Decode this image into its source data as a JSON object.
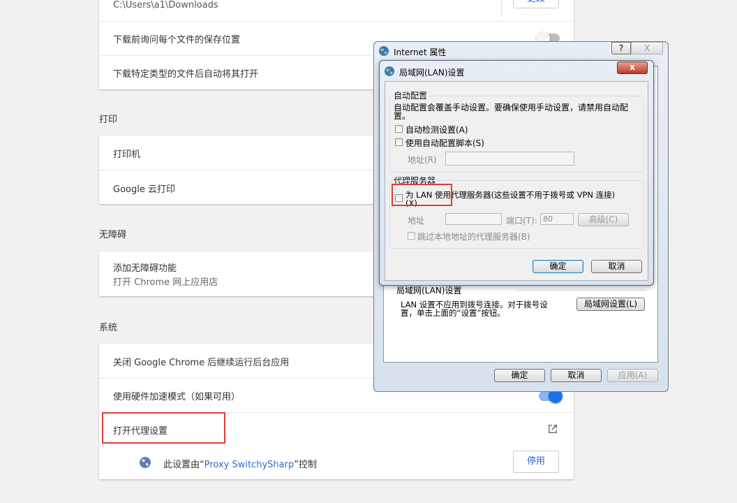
{
  "downloads": {
    "path": "C:\\Users\\a1\\Downloads",
    "change_label": "更改",
    "ask_where": "下载前询问每个文件的保存位置",
    "auto_open": "下载特定类型的文件后自动将其打开"
  },
  "print": {
    "section": "打印",
    "printers": "打印机",
    "cloud_print": "Google 云打印"
  },
  "accessibility": {
    "section": "无障碍",
    "add_title": "添加无障碍功能",
    "add_sub": "打开 Chrome 网上应用店"
  },
  "system": {
    "section": "系统",
    "background_apps": "关闭 Google Chrome 后继续运行后台应用",
    "hardware_accel": "使用硬件加速模式（如果可用）",
    "proxy": "打开代理设置",
    "ext_prefix": "此设置由“",
    "ext_name": "Proxy SwitchySharp",
    "ext_suffix": "”控制",
    "disable_label": "停用"
  },
  "inet": {
    "title": "Internet 属性",
    "help": "?",
    "close": "X",
    "lan_group": "局域网(LAN)设置",
    "lan_desc1": "LAN 设置不应用到拨号连接。对于拨号设",
    "lan_desc2": "置，单击上面的“设置”按钮。",
    "lan_button": "局域网设置(L)",
    "ok": "确定",
    "cancel": "取消",
    "apply": "应用(A)"
  },
  "lan": {
    "title": "局域网(LAN)设置",
    "close": "x",
    "auto_group": "自动配置",
    "auto_desc1": "自动配置会覆盖手动设置。要确保使用手动设置，请禁用自动配",
    "auto_desc2": "置。",
    "auto_detect": "自动检测设置(A)",
    "use_script": "使用自动配置脚本(S)",
    "address_label": "地址(R)",
    "proxy_group": "代理服务器",
    "use_proxy1": "为 LAN 使用代理服务器(这些设置不用于拨号或 VPN 连接)",
    "use_proxy2": "(X)",
    "proxy_address": "地址",
    "port_label": "端口(T):",
    "port_value": "80",
    "advanced": "高级(C)",
    "bypass_local": "跳过本地地址的代理服务器(B)",
    "ok": "确定",
    "cancel": "取消"
  },
  "colors": {
    "toggle_on": "#1a73e8",
    "highlight": "#e53935",
    "link": "#3367d6"
  }
}
